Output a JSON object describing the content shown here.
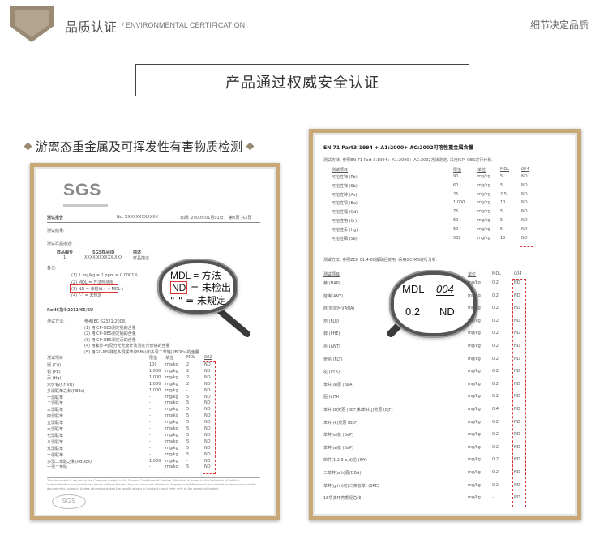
{
  "banner": {
    "title": "品质认证",
    "subtitle": "/ ENVIRONMENTAL CERTIFICATION",
    "right_text": "细节决定品质"
  },
  "headline": "产品通过权威安全认证",
  "section_label": "游离态重金属及可挥发性有害物质检测",
  "left_doc": {
    "logo_text": "SGS",
    "report_label": "测试报告",
    "report_number": "No. XXXXXXXXXXXX",
    "report_date": "日期: 2000年01月01日",
    "page_info": "第X页 共X页",
    "client_label": "测试结果:",
    "desc_label": "测试样品描述:",
    "sample_headers": [
      "样品编号",
      "SGS样品ID",
      "描述"
    ],
    "sample_row": [
      "1",
      "XXXX-XXXXXX.XXX",
      "样品描述"
    ],
    "notes_label": "备注:",
    "notes": [
      "(1) 1 mg/kg = 1 ppm = 0.0001%",
      "(2) MDL = 方法检测限",
      "(3) ND = 未检出 ( < MDL )",
      "(4) \"-\" = 未规定"
    ],
    "rohs_heading": "RoHS指令2011/65/EU",
    "method_label": "测试方法:",
    "method_lines": [
      "参考IEC 62321:2008。",
      "(1) 用ICP-OES测定铅的含量",
      "(2) 用ICP-OES测定镉的含量",
      "(3) 用ICP-OES测定汞的含量",
      "(4) 用紫外-可见分光光度计法测定六价铬的含量",
      "(5) 用GC-MS测定多溴联苯(PBBs)和多溴二苯醚(PBDEs)的含量"
    ],
    "table_headers": [
      "测试项目",
      "限值",
      "单位",
      "MDL",
      "001"
    ],
    "table_rows": [
      [
        "镉 (Cd)",
        "100",
        "mg/kg",
        "2",
        "ND"
      ],
      [
        "铅 (Pb)",
        "1,000",
        "mg/kg",
        "2",
        "ND"
      ],
      [
        "汞 (Hg)",
        "1,000",
        "mg/kg",
        "2",
        "ND"
      ],
      [
        "六价铬(Cr(VI))",
        "1,000",
        "mg/kg",
        "2",
        "ND"
      ],
      [
        "多溴联苯之和(PBBs)",
        "1,000",
        "mg/kg",
        "-",
        "ND"
      ],
      [
        "一溴联苯",
        "-",
        "mg/kg",
        "5",
        "ND"
      ],
      [
        "二溴联苯",
        "-",
        "mg/kg",
        "5",
        "ND"
      ],
      [
        "三溴联苯",
        "-",
        "mg/kg",
        "5",
        "ND"
      ],
      [
        "四溴联苯",
        "-",
        "mg/kg",
        "5",
        "ND"
      ],
      [
        "五溴联苯",
        "-",
        "mg/kg",
        "5",
        "ND"
      ],
      [
        "六溴联苯",
        "-",
        "mg/kg",
        "5",
        "ND"
      ],
      [
        "七溴联苯",
        "-",
        "mg/kg",
        "5",
        "ND"
      ],
      [
        "八溴联苯",
        "-",
        "mg/kg",
        "5",
        "ND"
      ],
      [
        "九溴联苯",
        "-",
        "mg/kg",
        "5",
        "ND"
      ],
      [
        "十溴联苯",
        "-",
        "mg/kg",
        "5",
        "ND"
      ],
      [
        "多溴二苯醚之和(PBDEs)",
        "1,000",
        "mg/kg",
        "-",
        "ND"
      ],
      [
        "一溴二苯醚",
        "-",
        "mg/kg",
        "5",
        "ND"
      ]
    ],
    "footer_text": "This document is issued by the Company subject to its General Conditions of Service. Attention is drawn to the limitation of liability, indemnification and jurisdiction issues defined therein. Any unauthorized alteration, forgery or falsification of the content or appearance of this document is unlawful. Unless otherwise stated the results shown in this test report refer only to the sample(s) tested.",
    "magnifier": {
      "line1": "MDL = 方法",
      "line2_key": "ND",
      "line2_value": " = 未检出",
      "line3": "\"-\" = 未规定"
    }
  },
  "right_doc": {
    "heading": "EN 71 Part3:1994 + A1:2000+ AC:2002可溶性重金属含量",
    "method_text_1": "测试方法:  参照EN 71 Part 3:1994+ A1:2000+ AC:2002方法测定, 采用ICP- OES进行分析.",
    "table1_headers": [
      "测试项目",
      "限值",
      "单位",
      "MDL",
      "004"
    ],
    "table1_rows": [
      [
        "可溶性锑 (Pb)",
        "90",
        "mg/kg",
        "5",
        "ND"
      ],
      [
        "可溶性锑 (Sb)",
        "60",
        "mg/kg",
        "5",
        "ND"
      ],
      [
        "可溶性砷 (As)",
        "25",
        "mg/kg",
        "2.5",
        "ND"
      ],
      [
        "可溶性钡 (Ba)",
        "1,000",
        "mg/kg",
        "10",
        "ND"
      ],
      [
        "可溶性镉 (Cd)",
        "75",
        "mg/kg",
        "5",
        "ND"
      ],
      [
        "可溶性铬 (Cr)",
        "60",
        "mg/kg",
        "5",
        "ND"
      ],
      [
        "可溶性汞 (Hg)",
        "60",
        "mg/kg",
        "5",
        "ND"
      ],
      [
        "可溶性硒 (Se)",
        "500",
        "mg/kg",
        "10",
        "ND"
      ]
    ],
    "method_text_2": "测试方法:    参照ZEK 01.4-08提取后使用, 采用GC-MS进行分析.",
    "table2_headers": [
      "测试项目",
      "单位",
      "MDL",
      "004"
    ],
    "table2_rows": [
      [
        "萘 (NAP)",
        "mg/kg",
        "0.2",
        "ND"
      ],
      [
        "苊烯(ANY)",
        "mg/kg",
        "0.2",
        "ND"
      ],
      [
        "苊(苊烷烃)(ANA)",
        "mg/kg",
        "0.2",
        "ND"
      ],
      [
        "芴 (FLU)",
        "mg/kg",
        "0.2",
        "ND"
      ],
      [
        "菲 (PHE)",
        "mg/kg",
        "0.2",
        "ND"
      ],
      [
        "蒽 (ANT)",
        "mg/kg",
        "0.2",
        "ND"
      ],
      [
        "荧蒽 (FLT)",
        "mg/kg",
        "0.2",
        "ND"
      ],
      [
        "芘 (PYR)",
        "mg/kg",
        "0.2",
        "ND"
      ],
      [
        "苯并(a)蒽 (BaA)",
        "mg/kg",
        "0.2",
        "ND"
      ],
      [
        "屈 (CHR)",
        "mg/kg",
        "0.2",
        "ND"
      ],
      [
        "苯并(b)荧蒽 (BbF)和苯并(j)荧蒽 (BjF)",
        "mg/kg",
        "0.4",
        "ND"
      ],
      [
        "苯并 (k)荧蒽 (BkF)",
        "mg/kg",
        "0.2",
        "ND"
      ],
      [
        "苯并(e)芘 (BeP)",
        "mg/kg",
        "0.2",
        "ND"
      ],
      [
        "苯并(a)芘 (BaP)",
        "mg/kg",
        "0.2",
        "ND"
      ],
      [
        "茚并(1,2,3-c,d)芘 (IPY)",
        "mg/kg",
        "0.2",
        "ND"
      ],
      [
        "二苯并(a,h)蒽(DBA)",
        "mg/kg",
        "0.2",
        "ND"
      ],
      [
        "苯并(g,h,i)苝(二萘嵌苯) (BPE)",
        "mg/kg",
        "0.2",
        "ND"
      ],
      [
        "18项多环芳香烃总和",
        "mg/kg",
        "-",
        "ND"
      ]
    ],
    "magnifier": {
      "header_left": "MDL",
      "header_right": "004",
      "value_left": "0.2",
      "value_right": "ND"
    }
  }
}
